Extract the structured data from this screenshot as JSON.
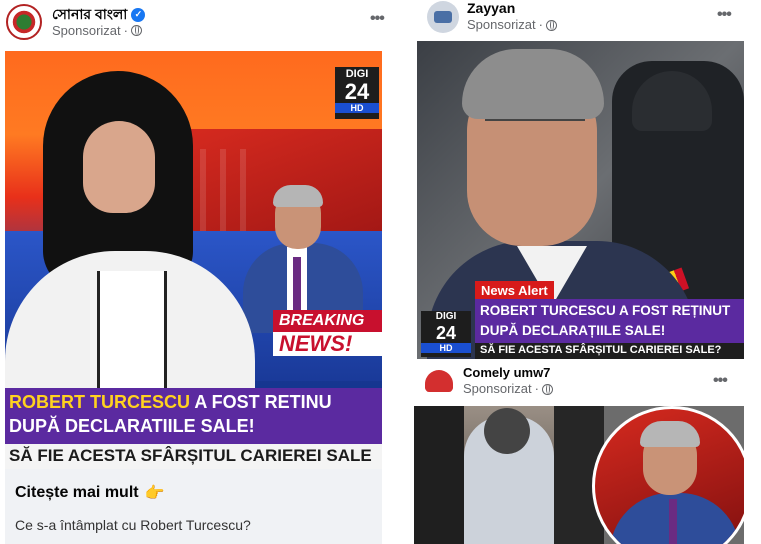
{
  "post1": {
    "page_name": "সোনার বাংলা",
    "sponsored": "Sponsorizat",
    "more": "•••",
    "channel_logo": "DIGI 24",
    "channel_logo_top": "DIGI",
    "channel_logo_num": "24",
    "channel_hd": "HD",
    "breaking_1": "BREAKING",
    "breaking_2": "NEWS!",
    "headline_name": "ROBERT TURCESCU",
    "headline_rest": " A FOST RETINU",
    "headline_line2": "DUPĂ DECLARATIILE SALE!",
    "ticker": "SĂ FIE ACESTA SFÂRȘITUL CARIEREI SALE",
    "cta_title": "Citește mai mult",
    "cta_emoji": "👉",
    "cta_desc": "Ce s-a întâmplat cu Robert Turcescu?"
  },
  "post2": {
    "page_name": "Zayyan",
    "sponsored": "Sponsorizat",
    "more": "•••",
    "news_alert": "News Alert",
    "headline_line1": "ROBERT TURCESCU A FOST REȚINUT",
    "headline_line2": "DUPĂ DECLARAȚIILE SALE!",
    "ticker": "SĂ FIE ACESTA SFÂRȘITUL CARIEREI SALE?",
    "channel_logo_top": "DIGI",
    "channel_logo_num": "24",
    "channel_hd": "HD"
  },
  "post3": {
    "page_name": "Comely umw7",
    "sponsored": "Sponsorizat",
    "more": "•••"
  },
  "colors": {
    "facebook_blue": "#1877f2",
    "banner_purple": "#5b2aa0",
    "alert_red": "#d71a1a",
    "muted_text": "#65676b"
  }
}
